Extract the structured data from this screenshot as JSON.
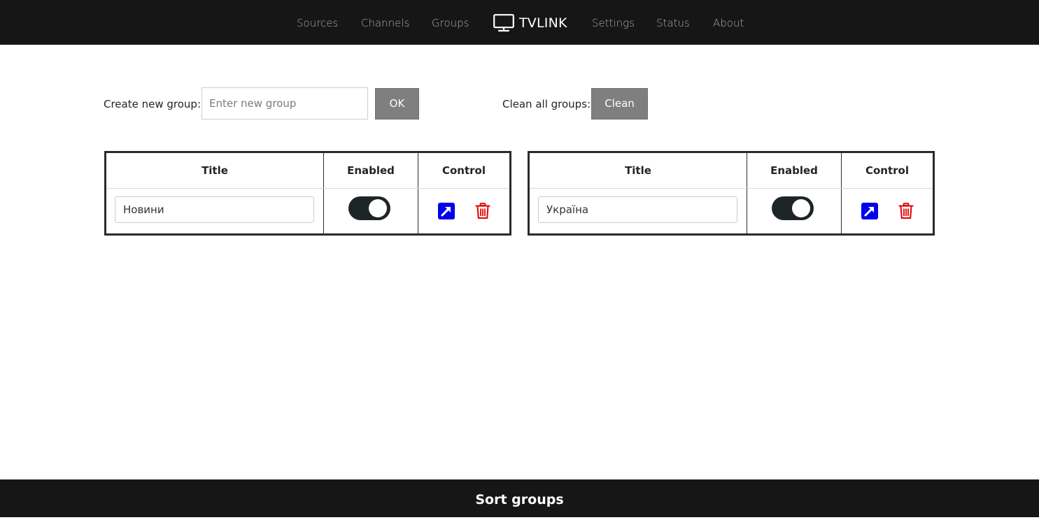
{
  "nav": {
    "brand": "TVLINK",
    "left_items": [
      {
        "label": "Sources"
      },
      {
        "label": "Channels"
      },
      {
        "label": "Groups"
      }
    ],
    "right_items": [
      {
        "label": "Settings"
      },
      {
        "label": "Status"
      },
      {
        "label": "About"
      }
    ]
  },
  "toolbar": {
    "create_label": "Create new group:",
    "input_placeholder": "Enter new group",
    "ok_button": "OK",
    "clean_label": "Clean all groups:",
    "clean_button": "Clean"
  },
  "table_headers": {
    "title": "Title",
    "enabled": "Enabled",
    "control": "Control"
  },
  "groups": [
    {
      "title": "Новини",
      "enabled": true
    },
    {
      "title": "Україна",
      "enabled": true
    }
  ],
  "footer": {
    "sort_label": "Sort groups"
  },
  "colors": {
    "navbar_bg": "#161616",
    "button_gray": "#7f7f7f",
    "toggle_on": "#1e2526",
    "edit_icon": "#0000ee",
    "delete_icon": "#e00000"
  },
  "icons": {
    "brand": "tv-icon",
    "edit": "external-link-arrow-icon",
    "delete": "trash-icon"
  }
}
